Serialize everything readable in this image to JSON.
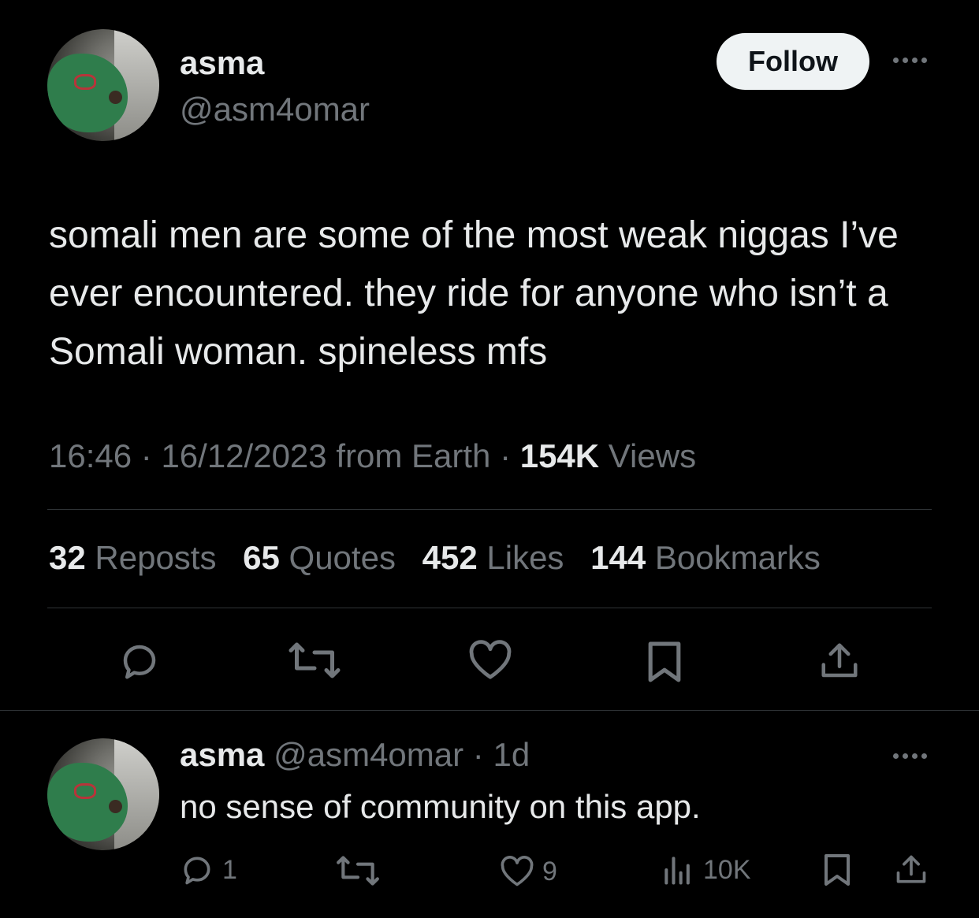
{
  "main_tweet": {
    "author_name": "asma",
    "author_handle": "@asm4omar",
    "follow_label": "Follow",
    "text": "somali men are some of the most weak niggas I’ve ever encountered. they ride for anyone who isn’t a Somali woman. spineless mfs",
    "time": "16:46",
    "date": "16/12/2023",
    "source": "from Earth",
    "views_count": "154K",
    "views_label": "Views",
    "stats": [
      {
        "count": "32",
        "label": "Reposts"
      },
      {
        "count": "65",
        "label": "Quotes"
      },
      {
        "count": "452",
        "label": "Likes"
      },
      {
        "count": "144",
        "label": "Bookmarks"
      }
    ]
  },
  "reply": {
    "author_name": "asma",
    "author_handle": "@asm4omar",
    "age": "1d",
    "text": "no sense of community on this app.",
    "reply_count": "1",
    "like_count": "9",
    "view_count": "10K"
  },
  "colors": {
    "background": "#000000",
    "text_primary": "#e7e9ea",
    "text_muted": "#71767b",
    "divider": "#2f3336",
    "follow_bg": "#eff3f4"
  },
  "icons": [
    "comment-icon",
    "repost-icon",
    "heart-icon",
    "bookmark-icon",
    "share-icon",
    "more-icon",
    "views-icon"
  ]
}
